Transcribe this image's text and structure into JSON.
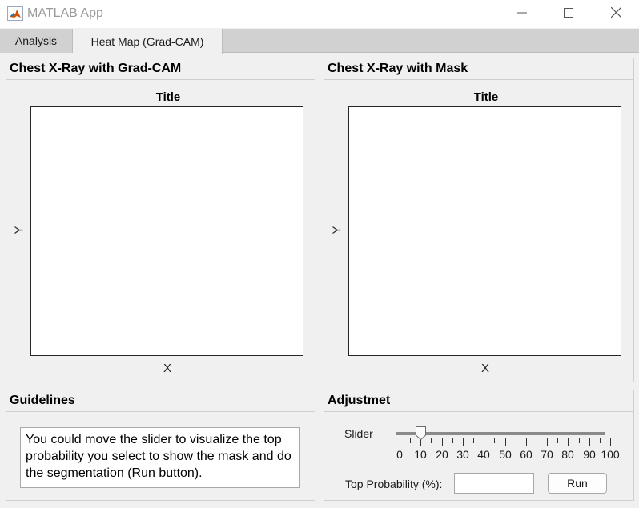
{
  "window": {
    "title": "MATLAB App",
    "controls": [
      "minimize-icon",
      "maximize-icon",
      "close-icon"
    ]
  },
  "tabs": [
    {
      "label": "Analysis",
      "selected": false
    },
    {
      "label": "Heat Map (Grad-CAM)",
      "selected": true
    }
  ],
  "gradcam_panel": {
    "header": "Chest X-Ray with Grad-CAM",
    "axes": {
      "title": "Title",
      "xlabel": "X",
      "ylabel": "Y"
    }
  },
  "mask_panel": {
    "header": "Chest X-Ray with Mask",
    "axes": {
      "title": "Title",
      "xlabel": "X",
      "ylabel": "Y"
    }
  },
  "guidelines_panel": {
    "header": "Guidelines",
    "text": "You could move the slider to visualize the top probability you select to show the mask and do the segmentation (Run button)."
  },
  "adjustment_panel": {
    "header": "Adjustmet",
    "slider": {
      "label": "Slider",
      "value": 10,
      "min": 0,
      "max": 100,
      "ticks": [
        "0",
        "10",
        "20",
        "30",
        "40",
        "50",
        "60",
        "70",
        "80",
        "90",
        "100"
      ]
    },
    "probability": {
      "label": "Top Probability (%):",
      "value": ""
    },
    "run_label": "Run"
  }
}
